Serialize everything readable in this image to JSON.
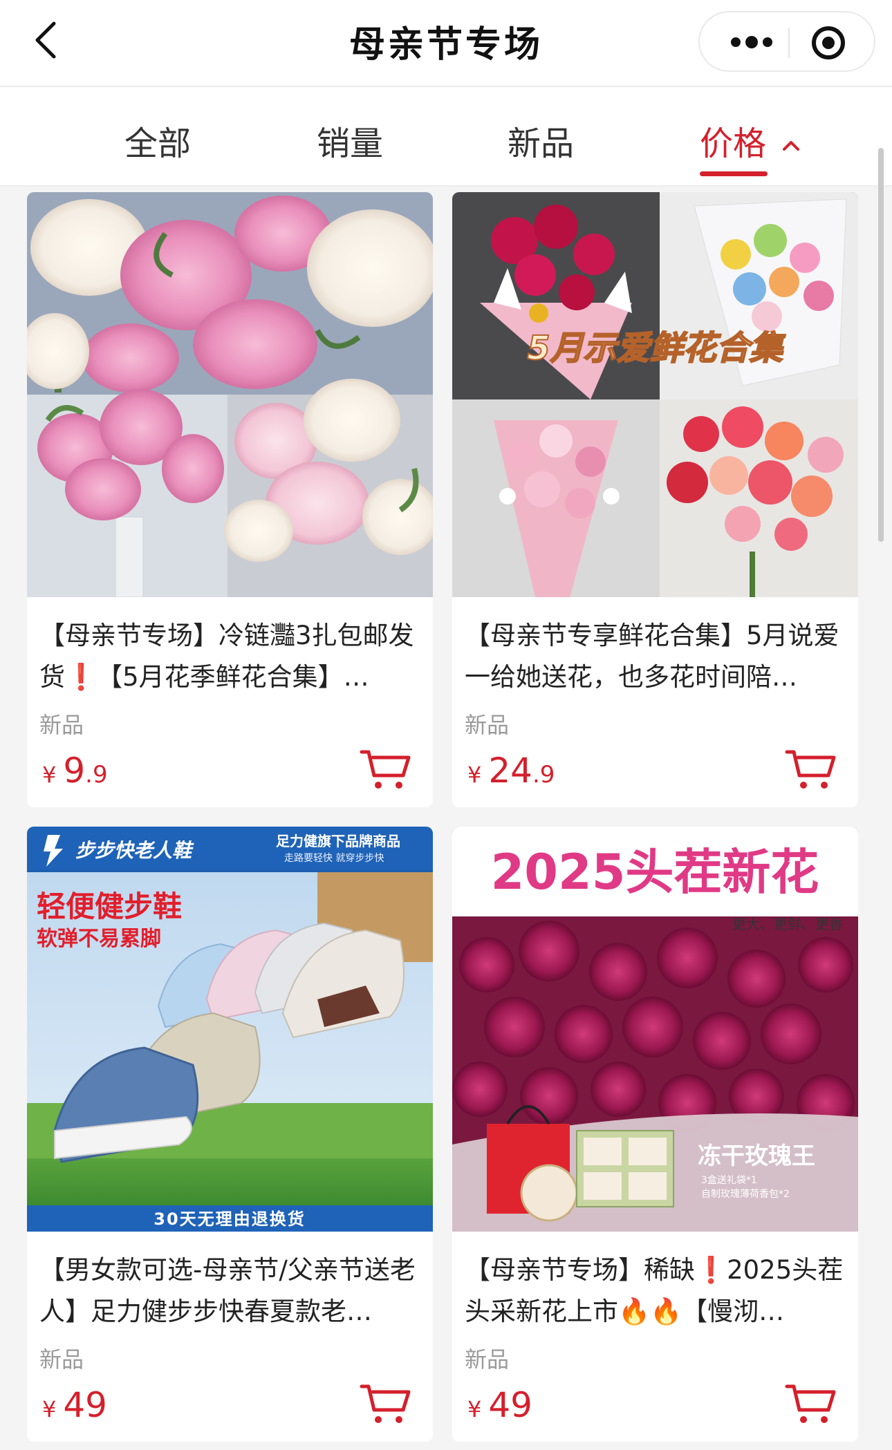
{
  "header": {
    "title": "母亲节专场"
  },
  "tabs": [
    {
      "label": "全部"
    },
    {
      "label": "销量"
    },
    {
      "label": "新品"
    },
    {
      "label": "价格"
    }
  ],
  "active_tab": "价格",
  "products": [
    {
      "name": "【母亲节专场】冷链灩3扎包邮发货❗【5月花季鲜花合集】…",
      "tag": "新品",
      "currency": "¥",
      "price_int": "9",
      "price_dec": ".9"
    },
    {
      "name": "【母亲节专享鲜花合集】5月说爱一给她送花，也多花时间陪…",
      "tag": "新品",
      "currency": "¥",
      "price_int": "24",
      "price_dec": ".9",
      "image_text": "5月示爱鲜花合集"
    },
    {
      "name": "【男女款可选-母亲节/父亲节送老人】足力健步步快春夏款老…",
      "tag": "新品",
      "currency": "¥",
      "price_int": "49",
      "price_dec": "",
      "image_text": {
        "brand": "步步快老人鞋",
        "store": "足力健旗下品牌商品",
        "store_sub": "走路要轻快 就穿步步快",
        "headline": "轻便健步鞋",
        "subline": "软弹不易累脚",
        "footer": "30天无理由退换货"
      }
    },
    {
      "name": "【母亲节专场】稀缺❗2025头茬头采新花上市🔥🔥【慢沏…",
      "tag": "新品",
      "currency": "¥",
      "price_int": "49",
      "price_dec": "",
      "image_text": {
        "headline": "2025头茬新花",
        "sub": "更大、更鲜、更香",
        "label": "冻干玫瑰王",
        "gift1": "3盒送礼袋*1",
        "gift2": "自制玫瑰薄荷香包*2"
      }
    }
  ],
  "colors": {
    "accent": "#d4202c",
    "tag": "#9a9a9a",
    "background": "#f4f4f4"
  }
}
